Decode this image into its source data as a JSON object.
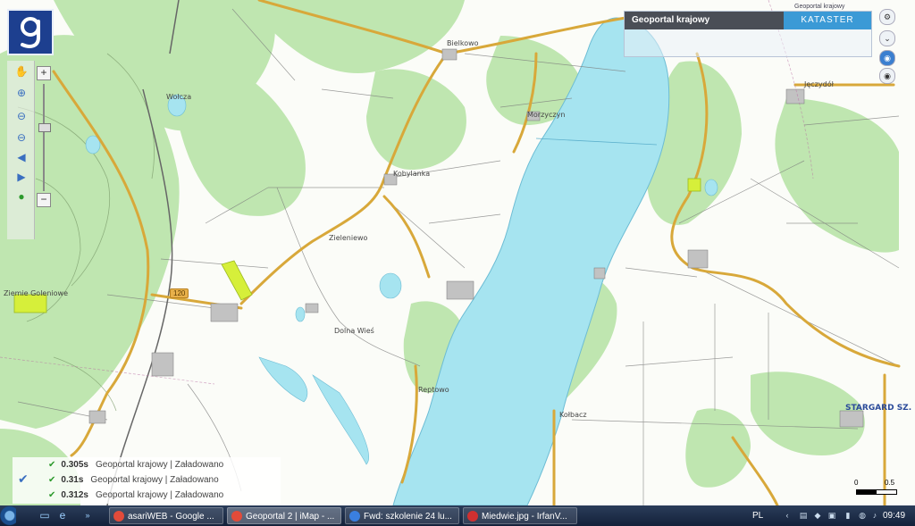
{
  "layer_panel": {
    "title": "Geoportal krajowy",
    "kataster": "KATASTER",
    "subtitle": "Geoportal krajowy"
  },
  "zoom": {
    "plus": "+",
    "minus": "−"
  },
  "map_labels": [
    "Bielkowo",
    "Wołcza",
    "Kobylanka",
    "Zieleniewo",
    "Morzyczyn",
    "Jęczydół",
    "Dolna Wieś",
    "Ziemie Goleniowe",
    "Reptowo",
    "Kołbacz"
  ],
  "city_label": "STARGARD SZ.",
  "road_shield": "120",
  "log": [
    {
      "time": "0.305s",
      "source": "Geoportal krajowy",
      "status": "Załadowano"
    },
    {
      "time": "0.31s",
      "source": "Geoportal krajowy",
      "status": "Załadowano"
    },
    {
      "time": "0.312s",
      "source": "Geoportal krajowy",
      "status": "Załadowano"
    }
  ],
  "scale": {
    "left": "0",
    "right": "0.5"
  },
  "taskbar": {
    "tasks": [
      {
        "label": "asariWEB - Google ...",
        "color": "#e24b3a"
      },
      {
        "label": "Geoportal 2 | iMap - ...",
        "color": "#e24b3a"
      },
      {
        "label": "Fwd: szkolenie 24 lu...",
        "color": "#3a7fe0"
      },
      {
        "label": "Miedwie.jpg - IrfanV...",
        "color": "#d03030"
      }
    ],
    "lang": "PL",
    "clock": "09:49"
  },
  "colors": {
    "lake": "#a6e4f0",
    "forest": "#bfe6b0",
    "road_major": "#d8a83a",
    "logo_bg": "#1d3f8f",
    "layer_title_bg": "#4a4e56",
    "kataster_bg": "#3b9ad6"
  },
  "icons": {
    "logo": "geoportal-g-icon",
    "pan": "hand-icon",
    "zoom_in": "zoom-in-icon",
    "zoom_out": "zoom-out-icon",
    "back": "arrow-left-icon",
    "forward": "arrow-right-icon",
    "info": "info-icon"
  }
}
